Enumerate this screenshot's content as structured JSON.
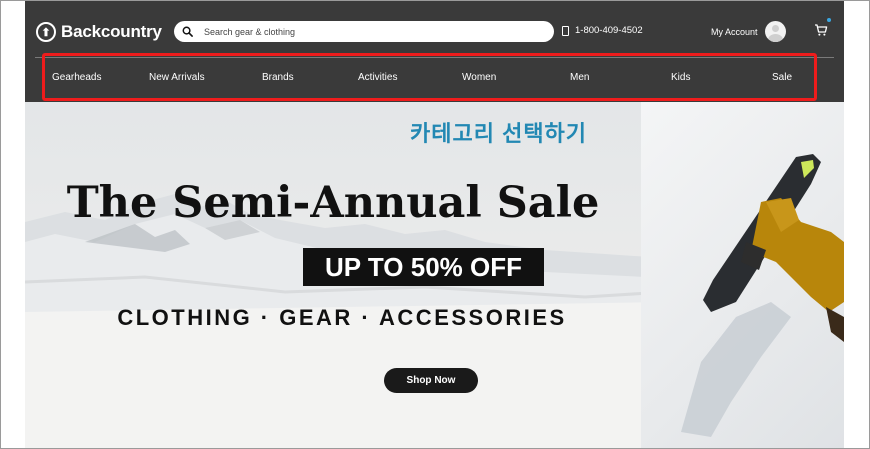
{
  "header": {
    "logo_text": "Backcountry",
    "search_placeholder": "Search gear & clothing",
    "phone": "1-800-409-4502",
    "account_label": "My Account"
  },
  "nav": {
    "items": [
      {
        "label": "Gearheads"
      },
      {
        "label": "New Arrivals"
      },
      {
        "label": "Brands"
      },
      {
        "label": "Activities"
      },
      {
        "label": "Women"
      },
      {
        "label": "Men"
      },
      {
        "label": "Kids"
      },
      {
        "label": "Sale"
      }
    ]
  },
  "annotation": {
    "text": "카테고리 선택하기",
    "highlight_color": "#ef1c1c",
    "text_color": "#2288b3"
  },
  "hero": {
    "headline": "The Semi-Annual Sale",
    "discount": "UP TO 50% OFF",
    "categories": "CLOTHING · GEAR · ACCESSORIES",
    "cta_label": "Shop Now"
  },
  "colors": {
    "header_bg": "#3a3a3a",
    "accent_dot": "#3aa7e0"
  }
}
